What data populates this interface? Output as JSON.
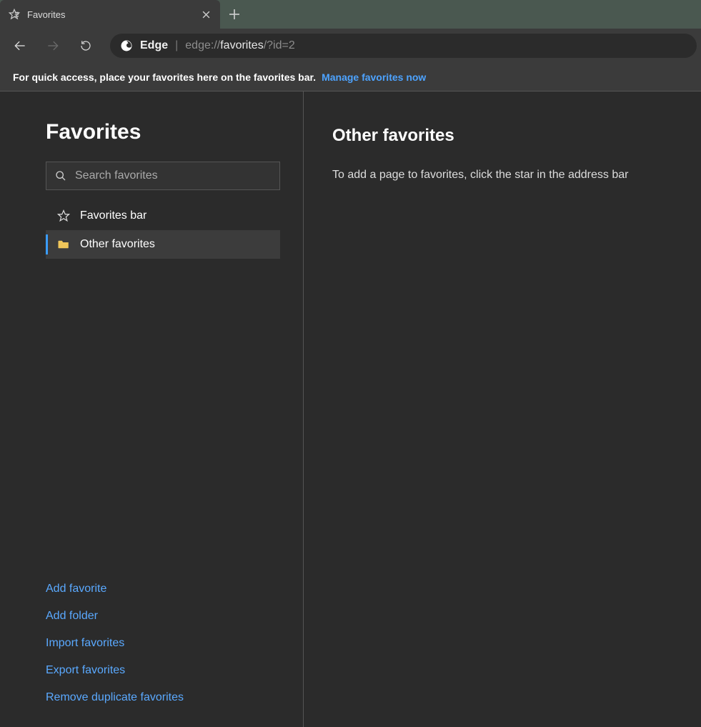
{
  "tab": {
    "title": "Favorites"
  },
  "address": {
    "label": "Edge",
    "url_prefix": "edge://",
    "url_main": "favorites",
    "url_suffix": "/?id=2"
  },
  "favhint": {
    "text": "For quick access, place your favorites here on the favorites bar.",
    "link": "Manage favorites now"
  },
  "sidebar": {
    "title": "Favorites",
    "search_placeholder": "Search favorites",
    "items": [
      {
        "label": "Favorites bar",
        "icon": "star",
        "selected": false
      },
      {
        "label": "Other favorites",
        "icon": "folder",
        "selected": true
      }
    ],
    "actions": [
      "Add favorite",
      "Add folder",
      "Import favorites",
      "Export favorites",
      "Remove duplicate favorites"
    ]
  },
  "main": {
    "heading": "Other favorites",
    "empty_text": "To add a page to favorites, click the star in the address bar"
  }
}
